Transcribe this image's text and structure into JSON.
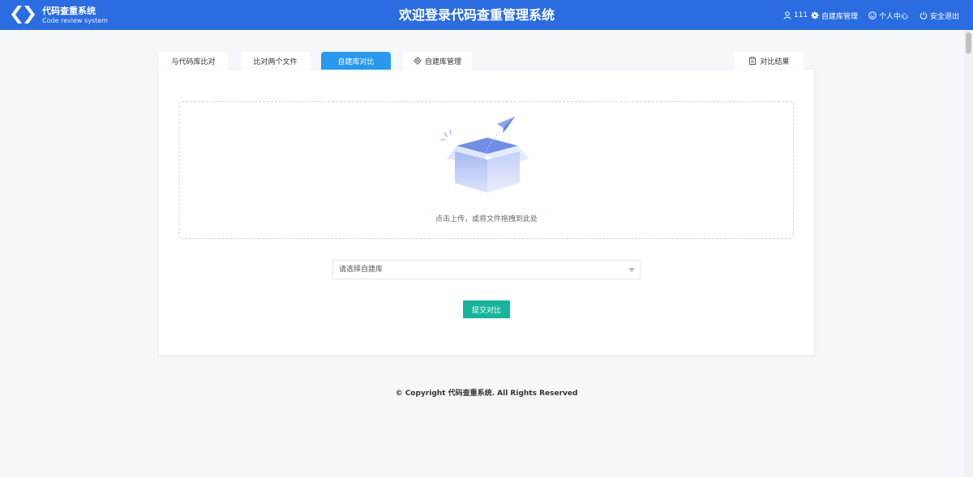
{
  "header": {
    "brand_title": "代码查重系统",
    "brand_subtitle": "Code review system",
    "main_title": "欢迎登录代码查重管理系统",
    "nav": {
      "user": "111",
      "library_manage": "自建库管理",
      "profile": "个人中心",
      "logout": "安全退出"
    },
    "logo_icon": "chevrons-logo-icon",
    "color": "#2b6de0"
  },
  "tabs": [
    {
      "label": "与代码库比对",
      "active": false
    },
    {
      "label": "比对两个文件",
      "active": false
    },
    {
      "label": "自建库对比",
      "active": true
    },
    {
      "label": "自建库管理",
      "active": false,
      "icon": "gear-icon"
    }
  ],
  "result_tab": {
    "label": "对比结果",
    "icon": "clipboard-icon"
  },
  "upload": {
    "text": "点击上传，或将文件拖拽到此处",
    "icon": "box-paper-plane-illustration"
  },
  "select": {
    "placeholder": "请选择自建库"
  },
  "submit": {
    "label": "提交对比",
    "color": "#16b59b"
  },
  "footer": {
    "copyright": "© Copyright 代码查重系统. All Rights Reserved"
  },
  "accent_color": "#2b98f0"
}
